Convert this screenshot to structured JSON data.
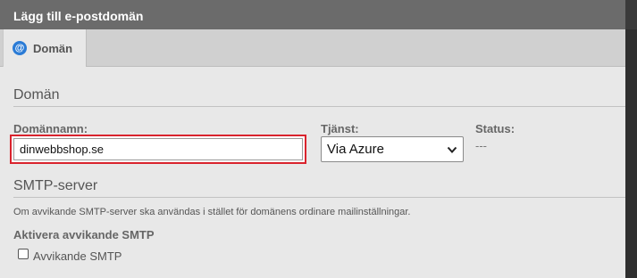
{
  "dialog": {
    "title": "Lägg till e-postdomän"
  },
  "tabs": [
    {
      "label": "Domän",
      "icon": "at-icon",
      "selected": true
    }
  ],
  "domain_section": {
    "heading": "Domän",
    "domain_name": {
      "label": "Domännamn:",
      "value": "dinwebbshop.se"
    },
    "service": {
      "label": "Tjänst:",
      "selected": "Via Azure"
    },
    "status": {
      "label": "Status:",
      "value": "---"
    }
  },
  "smtp_section": {
    "heading": "SMTP-server",
    "description": "Om avvikande SMTP-server ska användas i stället för domänens ordinare mailinställningar.",
    "enable_heading": "Aktivera avvikande SMTP",
    "checkbox": {
      "label": "Avvikande SMTP",
      "checked": false
    }
  },
  "colors": {
    "titlebar": "#6b6b6b",
    "highlight": "#d9232d",
    "icon_blue": "#2a7bd6"
  }
}
